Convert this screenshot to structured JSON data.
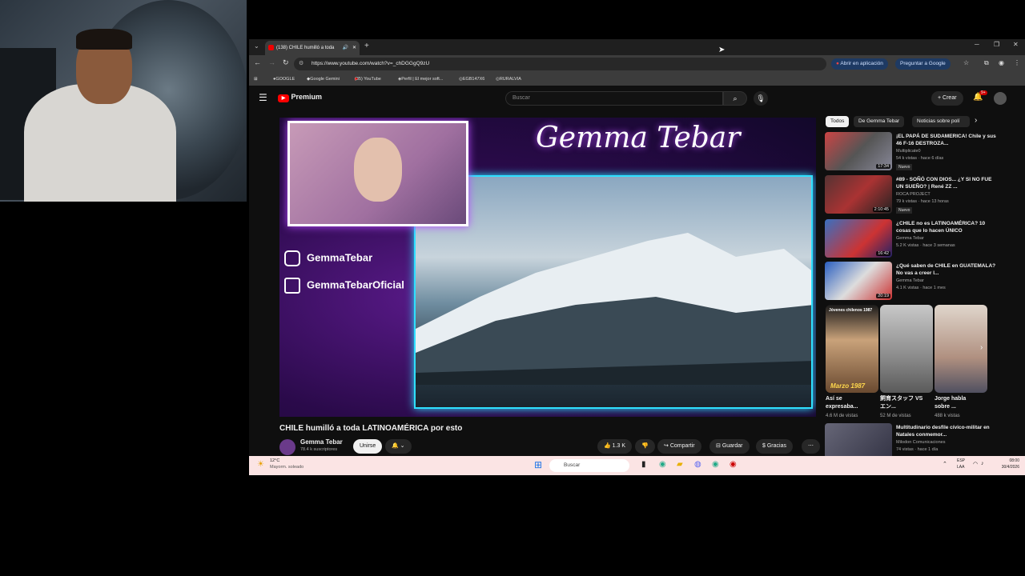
{
  "browser": {
    "tab_title": "(138) CHILE humilló a toda",
    "url": "https://www.youtube.com/watch?v=_chDGGgQ9zU",
    "open_in_app": "Abrir en aplicación",
    "ask_google": "Preguntar a Google",
    "bookmarks": [
      "GOOGLE",
      "Google Gemini",
      "(35) YouTube",
      "Perfil | El mejor soft...",
      "EGB147X6",
      "RURALVIA"
    ]
  },
  "youtube": {
    "logo": "Premium",
    "search_placeholder": "Buscar",
    "create_label": "Crear",
    "notif_badge": "9+",
    "overlay": {
      "channel_title": "Gemma Tebar",
      "instagram": "GemmaTebar",
      "tiktok": "GemmaTebarOficial"
    },
    "video": {
      "title": "CHILE humilló a toda LATINOAMÉRICA por esto",
      "channel": "Gemma Tebar",
      "subscribers": "78.4 k suscriptores",
      "join": "Unirse",
      "likes": "1.3 K",
      "share": "Compartir",
      "save": "Guardar",
      "thanks": "Gracias"
    },
    "chips": [
      "Todos",
      "De Gemma Tebar",
      "Noticias sobre polí"
    ],
    "recommendations": [
      {
        "title": "¡EL PAPÁ DE SUDAMERICA! Chile y sus 46 F-16 DESTROZA...",
        "channel": "Multiplicate0",
        "views": "54 k vistas · hace 6 días",
        "duration": "17:34",
        "badge": "Nuevo"
      },
      {
        "title": "#89 - SOÑÓ CON DIOS... ¿Y SI NO FUE UN SUEÑO? | René ZZ ...",
        "channel": "ROCA PROJECT",
        "views": "79 k vistas · hace 13 horas",
        "duration": "2:10:45",
        "badge": "Nuevo"
      },
      {
        "title": "¿CHILE no es LATINOAMÉRICA? 10 cosas que lo hacen ÚNICO",
        "channel": "Gemma Tebar",
        "views": "5.2 K vistas · hace 3 semanas",
        "duration": "16:42",
        "badge": ""
      },
      {
        "title": "¿Qué saben de CHILE en GUATEMALA? No vas a creer l...",
        "channel": "Gemma Tebar",
        "views": "4.1 K vistas · hace 1 mes",
        "duration": "20:19",
        "badge": ""
      }
    ],
    "shorts": [
      {
        "title": "Así se expresaba...",
        "views": "4.6 M de vistas",
        "overlay": "Marzo 1987",
        "top": "Jóvenes chilenos 1987"
      },
      {
        "title": "飼育スタッフ VS エン...",
        "views": "52 M de vistas"
      },
      {
        "title": "Jorge habla sobre ...",
        "views": "488 k vistas"
      }
    ],
    "last_rec": {
      "title": "Multitudinario desfile cívico-militar en Natales conmemor...",
      "channel": "Milodon Comunicaciones",
      "views": "74 vistas · hace 1 día"
    }
  },
  "taskbar": {
    "weather_temp": "12°C",
    "weather_desc": "Mayorm. soleado",
    "search": "Buscar",
    "lang": "ESP",
    "lang2": "LAA",
    "time": "08:00",
    "date": "30/4/2026"
  }
}
